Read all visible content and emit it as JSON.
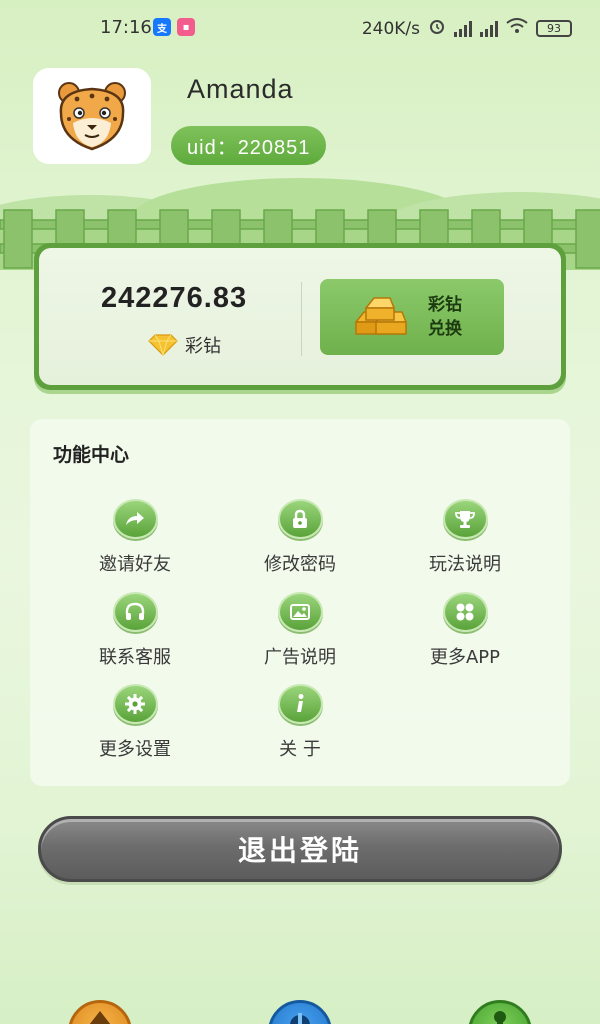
{
  "status_bar": {
    "time": "17:16",
    "network_speed": "240K/s",
    "battery": "93"
  },
  "profile": {
    "username": "Amanda",
    "uid_label": "uid：220851"
  },
  "balance": {
    "amount": "242276.83",
    "unit_label": "彩钻",
    "exchange_line1": "彩钻",
    "exchange_line2": "兑换"
  },
  "function_center": {
    "title": "功能中心",
    "items": [
      {
        "label": "邀请好友",
        "icon": "share-icon"
      },
      {
        "label": "修改密码",
        "icon": "lock-icon"
      },
      {
        "label": "玩法说明",
        "icon": "trophy-icon"
      },
      {
        "label": "联系客服",
        "icon": "headset-icon"
      },
      {
        "label": "广告说明",
        "icon": "image-icon"
      },
      {
        "label": "更多APP",
        "icon": "apps-grid-icon"
      },
      {
        "label": "更多设置",
        "icon": "gear-icon"
      },
      {
        "label": "关 于",
        "icon": "info-icon"
      }
    ]
  },
  "logout": {
    "label": "退出登陆"
  },
  "colors": {
    "accent_green": "#6fb14c",
    "dark_green": "#5fa03e",
    "logout_gray": "#6d6d6d"
  }
}
